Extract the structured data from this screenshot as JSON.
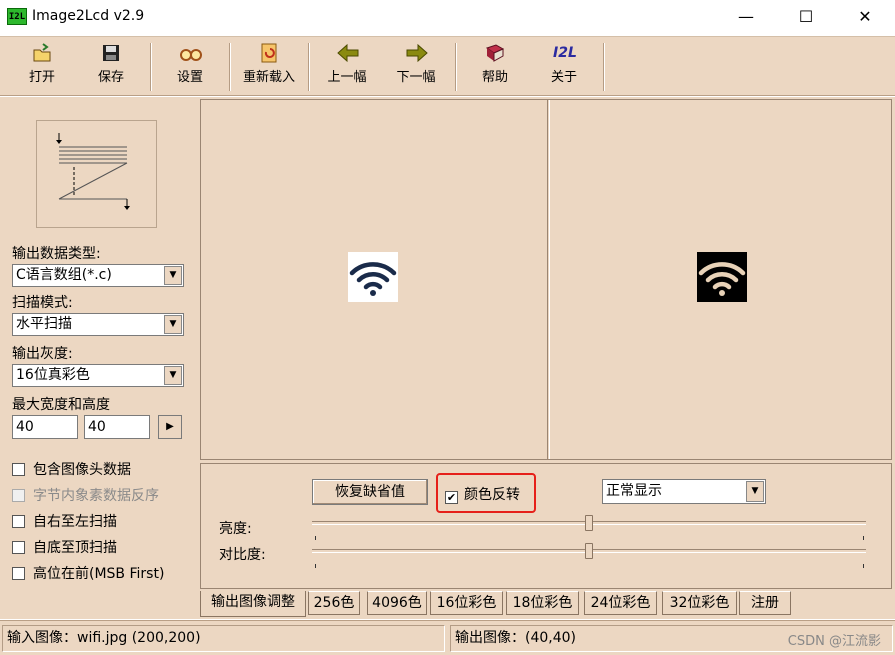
{
  "app": {
    "icon_text": "I2L",
    "title": "Image2Lcd v2.9"
  },
  "window_controls": {
    "minimize": "—",
    "maximize": "☐",
    "close": "✕"
  },
  "toolbar": [
    {
      "label": "打开",
      "icon": "open-folder-icon"
    },
    {
      "label": "保存",
      "icon": "save-disk-icon"
    },
    {
      "label": "设置",
      "icon": "settings-glasses-icon"
    },
    {
      "label": "重新载入",
      "icon": "reload-icon"
    },
    {
      "label": "上一幅",
      "icon": "arrow-left-icon"
    },
    {
      "label": "下一幅",
      "icon": "arrow-right-icon"
    },
    {
      "label": "帮助",
      "icon": "help-book-icon"
    },
    {
      "label": "关于",
      "icon": "about-i2l-icon",
      "text": "I2L"
    }
  ],
  "left_panel": {
    "output_type_label": "输出数据类型:",
    "output_type_value": "C语言数组(*.c)",
    "scan_mode_label": "扫描模式:",
    "scan_mode_value": "水平扫描",
    "gray_label": "输出灰度:",
    "gray_value": "16位真彩色",
    "max_size_label": "最大宽度和高度",
    "max_width": "40",
    "max_height": "40",
    "options": [
      {
        "label": "包含图像头数据",
        "checked": false,
        "enabled": true
      },
      {
        "label": "字节内象素数据反序",
        "checked": false,
        "enabled": false
      },
      {
        "label": "自右至左扫描",
        "checked": false,
        "enabled": true
      },
      {
        "label": "自底至顶扫描",
        "checked": false,
        "enabled": true
      },
      {
        "label": "高位在前(MSB First)",
        "checked": false,
        "enabled": true
      }
    ]
  },
  "adjust_panel": {
    "restore_button": "恢复缺省值",
    "invert_label": "颜色反转",
    "invert_checked": true,
    "display_mode": "正常显示",
    "brightness_label": "亮度:",
    "contrast_label": "对比度:",
    "brightness_level": 0.5,
    "contrast_level": 0.5,
    "highlight_color": "#e6201a"
  },
  "tabs": [
    "输出图像调整",
    "256色",
    "4096色",
    "16位彩色",
    "18位彩色",
    "24位彩色",
    "32位彩色",
    "注册"
  ],
  "active_tab": "输出图像调整",
  "status": {
    "input": "输入图像：wifi.jpg (200,200)",
    "output": "输出图像：(40,40)"
  },
  "watermark": "CSDN @江流影",
  "colors": {
    "background": "#ecd7c2",
    "wifi_input": "#1a2b4a",
    "wifi_output": "#e8d2b8"
  }
}
